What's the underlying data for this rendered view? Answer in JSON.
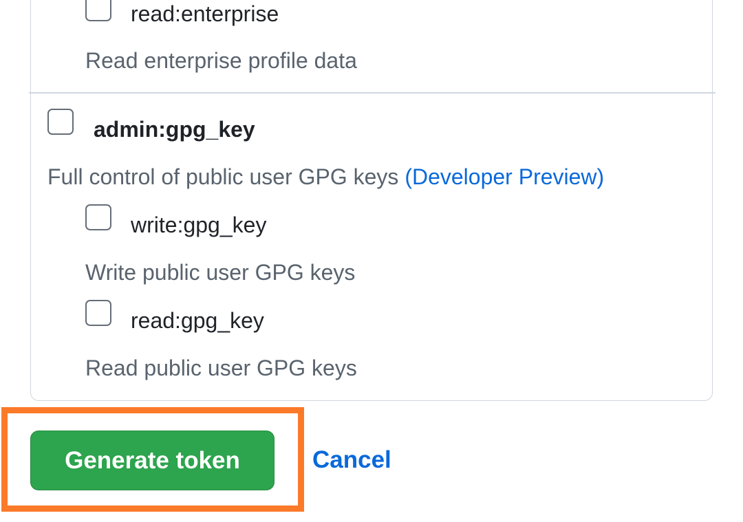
{
  "scopes": {
    "read_enterprise": {
      "label": "read:enterprise",
      "description": "Read enterprise profile data"
    },
    "admin_gpg_key": {
      "label": "admin:gpg_key",
      "description": "Full control of public user GPG keys",
      "preview_link": "(Developer Preview)"
    },
    "write_gpg_key": {
      "label": "write:gpg_key",
      "description": "Write public user GPG keys"
    },
    "read_gpg_key": {
      "label": "read:gpg_key",
      "description": "Read public user GPG keys"
    }
  },
  "actions": {
    "generate_label": "Generate token",
    "cancel_label": "Cancel"
  },
  "colors": {
    "primary_button": "#2da44e",
    "link": "#0969da",
    "highlight": "#fb7a2a"
  }
}
